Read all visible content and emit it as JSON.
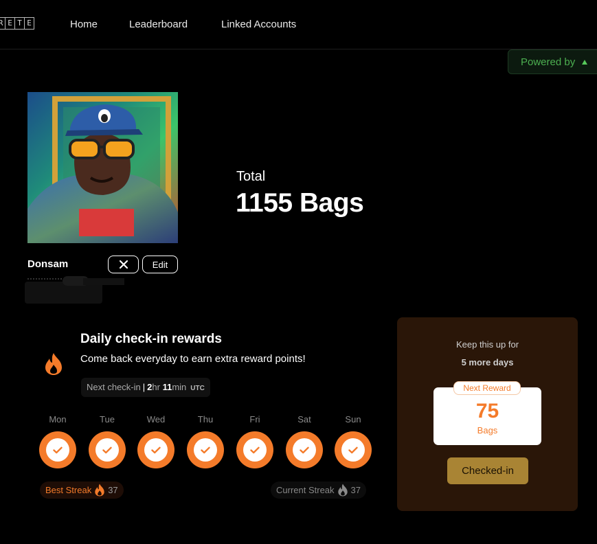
{
  "nav": {
    "logo_letters": [
      "R",
      "E",
      "T",
      "E"
    ],
    "links": [
      "Home",
      "Leaderboard",
      "Linked Accounts"
    ],
    "powered_by": "Powered by"
  },
  "profile": {
    "username": "Donsam",
    "edit_label": "Edit",
    "close_icon": "close-icon",
    "avatar_description_icon": "avatar-image"
  },
  "total": {
    "label": "Total",
    "value": "1155 Bags"
  },
  "checkin": {
    "title": "Daily check-in rewards",
    "subtitle": "Come back everyday to earn extra reward points!",
    "next_label": "Next check-in",
    "next_sep": "|",
    "hours": "2",
    "hours_unit": "hr",
    "minutes": "11",
    "minutes_unit": "min",
    "tz": "UTC",
    "days": [
      "Mon",
      "Tue",
      "Wed",
      "Thu",
      "Fri",
      "Sat",
      "Sun"
    ],
    "best_streak_label": "Best Streak",
    "best_streak_value": "37",
    "current_streak_label": "Current Streak",
    "current_streak_value": "37"
  },
  "reward": {
    "keep_up": "Keep this up for",
    "more_days": "5 more days",
    "next_reward_label": "Next Reward",
    "value": "75",
    "unit": "Bags",
    "button": "Checked-in"
  },
  "colors": {
    "accent_orange": "#f47b2a",
    "panel_brown": "#2a1608",
    "button_gold": "#a98434",
    "powered_green": "#4caf50"
  }
}
